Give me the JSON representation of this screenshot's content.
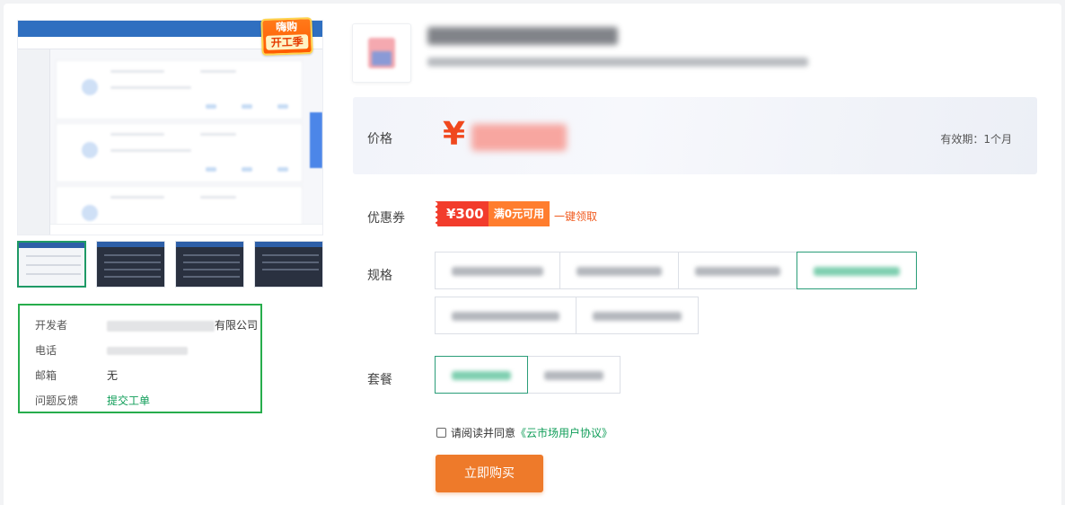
{
  "badge": {
    "line1": "嗨购",
    "line2": "开工季"
  },
  "developer_panel": {
    "rows": [
      {
        "label": "开发者",
        "value_suffix": "有限公司"
      },
      {
        "label": "电话",
        "value": ""
      },
      {
        "label": "邮箱",
        "value": "无"
      },
      {
        "label": "问题反馈",
        "value": "提交工单"
      }
    ]
  },
  "price": {
    "label": "价格",
    "currency_symbol": "¥",
    "validity": "有效期：1个月"
  },
  "coupon": {
    "label": "优惠券",
    "amount": "¥300",
    "condition": "满0元可用",
    "claim_link": "一键领取"
  },
  "spec": {
    "label": "规格"
  },
  "package": {
    "label": "套餐"
  },
  "agreement": {
    "text": "请阅读并同意",
    "link": "《云市场用户协议》"
  },
  "buy_button": "立即购买",
  "colors": {
    "accent_green": "#0f9d58",
    "buy_orange": "#ee7a2a",
    "price_red": "#f0481e",
    "coupon_red": "#f23c2c"
  }
}
